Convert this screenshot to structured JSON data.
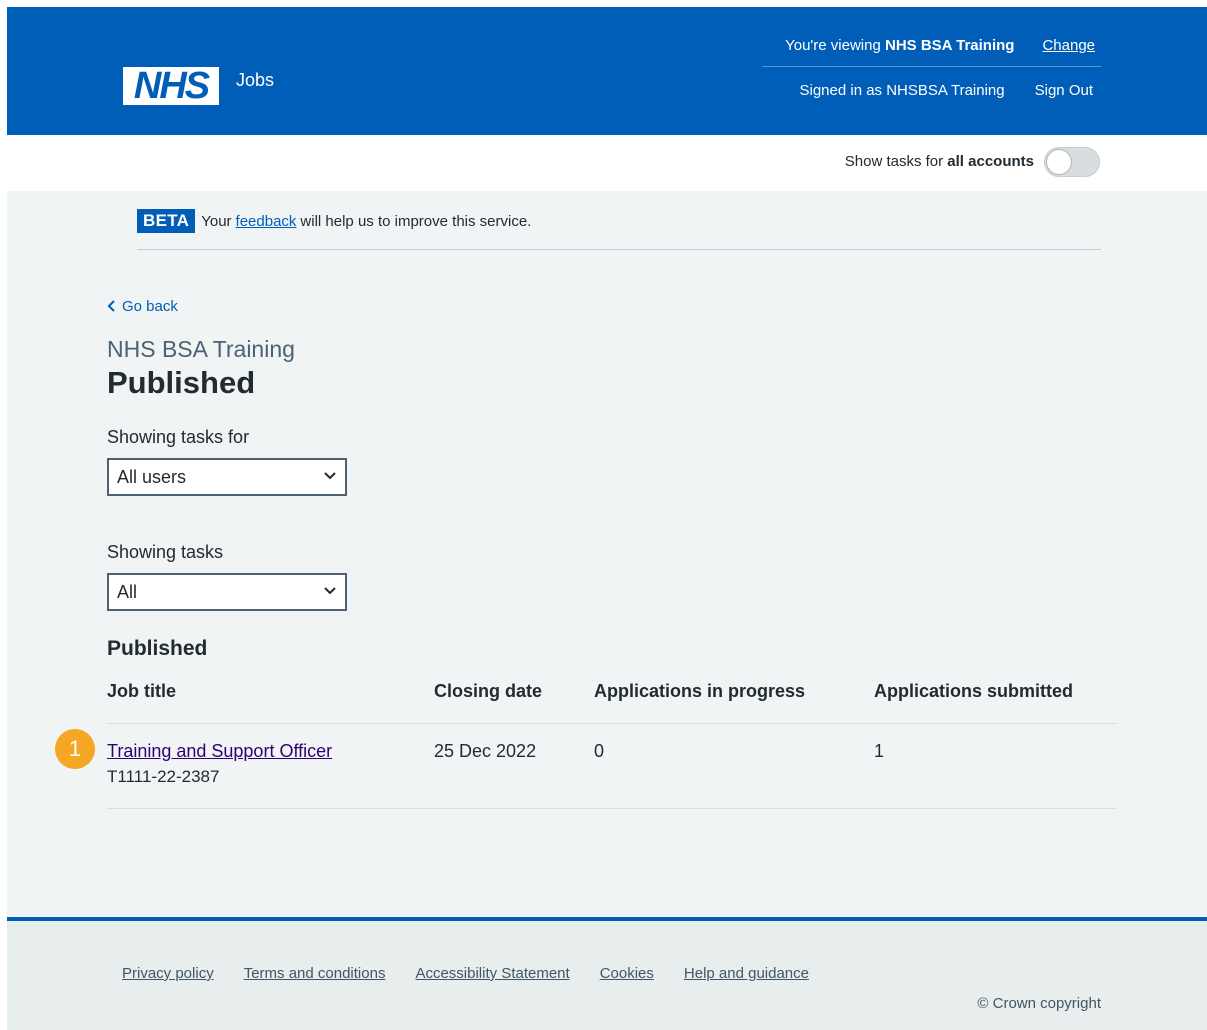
{
  "header": {
    "logo_text": "NHS",
    "service_name": "Jobs",
    "viewing_prefix": "You're viewing ",
    "viewing_org": "NHS BSA Training",
    "change_label": "Change",
    "signed_in_text": "Signed in as NHSBSA Training",
    "sign_out_label": "Sign Out"
  },
  "toggle_bar": {
    "label_prefix": "Show tasks for ",
    "label_bold": "all accounts",
    "toggle_on": false
  },
  "beta_banner": {
    "tag": "BETA",
    "text_before": "Your",
    "link": "feedback",
    "text_after": "will help us to improve this service."
  },
  "main": {
    "back_label": "Go back",
    "org_caption": "NHS BSA Training",
    "title": "Published",
    "filter_users": {
      "label": "Showing tasks for",
      "selected": "All users"
    },
    "filter_tasks": {
      "label": "Showing tasks",
      "selected": "All"
    },
    "table": {
      "heading": "Published",
      "columns": [
        "Job title",
        "Closing date",
        "Applications in progress",
        "Applications submitted"
      ],
      "rows": [
        {
          "job_title": "Training and Support Officer",
          "job_ref": "T1111-22-2387",
          "closing_date": "25 Dec 2022",
          "in_progress": "0",
          "submitted": "1"
        }
      ]
    },
    "step_badge": "1"
  },
  "footer": {
    "links": [
      "Privacy policy",
      "Terms and conditions",
      "Accessibility Statement",
      "Cookies",
      "Help and guidance"
    ],
    "copyright": "© Crown copyright"
  },
  "colors": {
    "nhs_blue": "#005eb8",
    "page_bg": "#f0f4f5",
    "visited_link": "#330072",
    "badge": "#f5a623"
  }
}
